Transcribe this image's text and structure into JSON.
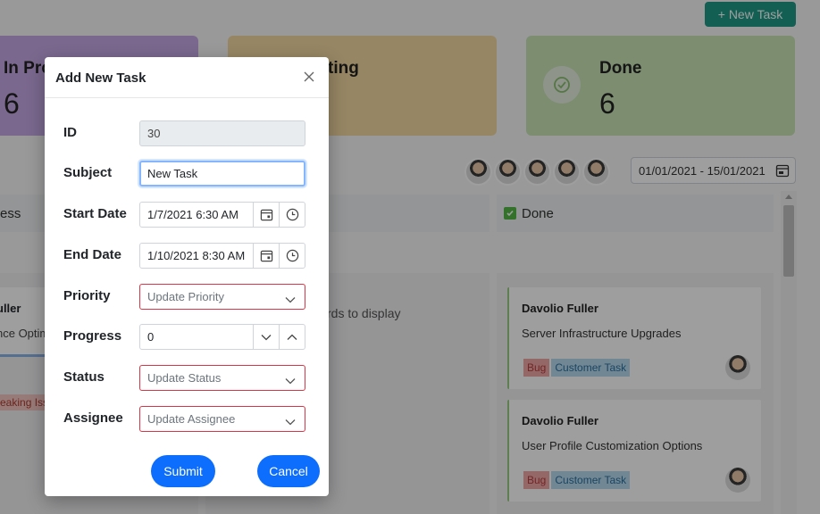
{
  "toolbar": {
    "new_task_label": "+ New Task"
  },
  "stats": {
    "in_progress": {
      "title": "In Pro",
      "count": "6"
    },
    "waiting": {
      "title": "ting"
    },
    "done": {
      "title": "Done",
      "count": "6"
    }
  },
  "date_range": "01/01/2021 - 15/01/2021",
  "columns": {
    "in_progress": "ess",
    "waiting_empty": "rds to display",
    "done": "Done"
  },
  "left_card": {
    "assignee": "uller",
    "summary": "nce Optim",
    "tag": "eaking Iss"
  },
  "done_cards": [
    {
      "assignee": "Davolio Fuller",
      "summary": "Server Infrastructure Upgrades",
      "tags": [
        "Bug",
        "Customer Task"
      ]
    },
    {
      "assignee": "Davolio Fuller",
      "summary": "User Profile Customization Options",
      "tags": [
        "Bug",
        "Customer Task"
      ]
    }
  ],
  "dialog": {
    "title": "Add New Task",
    "fields": {
      "id": {
        "label": "ID",
        "value": "30"
      },
      "subject": {
        "label": "Subject",
        "value": "New Task"
      },
      "start_date": {
        "label": "Start Date",
        "value": "1/7/2021 6:30 AM"
      },
      "end_date": {
        "label": "End Date",
        "value": "1/10/2021 8:30 AM"
      },
      "priority": {
        "label": "Priority",
        "placeholder": "Update Priority"
      },
      "progress": {
        "label": "Progress",
        "value": "0"
      },
      "status": {
        "label": "Status",
        "placeholder": "Update Status"
      },
      "assignee": {
        "label": "Assignee",
        "placeholder": "Update Assignee"
      }
    },
    "submit_label": "Submit",
    "cancel_label": "Cancel"
  },
  "colors": {
    "accent": "#0d6efd",
    "new_task": "#1f9a86",
    "invalid": "#dc3545",
    "card_in_progress": "#c6a9e6",
    "card_waiting": "#f3d9a2",
    "card_done": "#c9e4b5"
  }
}
